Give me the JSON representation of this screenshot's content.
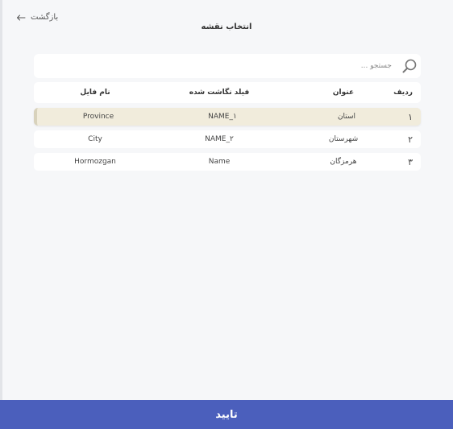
{
  "header": {
    "back_label": "بازگشت",
    "title": "انتخاب نقشه"
  },
  "search": {
    "placeholder": "جستجو ..."
  },
  "table": {
    "columns": {
      "radif": "ردیف",
      "title": "عنوان",
      "mapped_field": "فیلد نگاشت شده",
      "file_name": "نام فایل"
    },
    "rows": [
      {
        "radif": "۱",
        "title": "استان",
        "mapped_field": "NAME_۱",
        "file_name": "Province",
        "selected": true
      },
      {
        "radif": "۲",
        "title": "شهرستان",
        "mapped_field": "NAME_۲",
        "file_name": "City",
        "selected": false
      },
      {
        "radif": "۳",
        "title": "هرمزگان",
        "mapped_field": "Name",
        "file_name": "Hormozgan",
        "selected": false
      }
    ]
  },
  "footer": {
    "confirm_label": "تایید"
  },
  "colors": {
    "accent": "#4b5fbc",
    "selected_row": "#f1ecdc",
    "background": "#f6f7f9"
  }
}
